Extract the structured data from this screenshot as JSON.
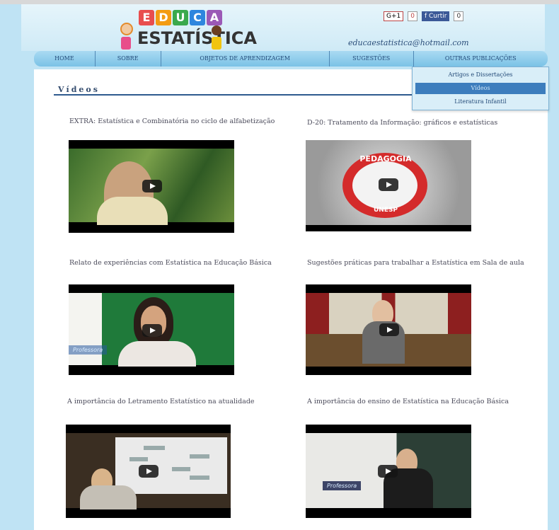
{
  "header": {
    "logo_text_top": "EDUCA",
    "logo_text_bottom": "ESTATÍSTICA",
    "email": "educaestatistica@hotmail.com",
    "social": {
      "gplus": "G+1",
      "gplus_count": "0",
      "like_label": "Curtir",
      "like_count": "0"
    }
  },
  "nav": {
    "items": [
      {
        "label": "HOME"
      },
      {
        "label": "SOBRE"
      },
      {
        "label": "OBJETOS DE APRENDIZAGEM"
      },
      {
        "label": "SUGESTÕES"
      },
      {
        "label": "OUTRAS PUBLICAÇÕES"
      }
    ],
    "dropdown": [
      {
        "label": "Artigos e Dissertações"
      },
      {
        "label": "Vídeos"
      },
      {
        "label": "Literatura Infantil"
      }
    ]
  },
  "page": {
    "title": "Vídeos"
  },
  "videos": [
    {
      "title": "EXTRA: Estatística e Combinatória no ciclo de alfabetização"
    },
    {
      "title": "D-20: Tratamento da Informação: gráficos e estatísticas"
    },
    {
      "title": "Relato de experiências com Estatística na Educação Básica"
    },
    {
      "title": "Sugestões práticas para trabalhar a Estatística em Sala de aula"
    },
    {
      "title": "A importância do Letramento Estatístico na atualidade"
    },
    {
      "title": "A importância do ensino de Estatística na Educação Básica"
    }
  ],
  "video_overlays": {
    "pedagogia_top": "PEDAGOGIA",
    "pedagogia_bottom": "UNESP",
    "banner": "Professora"
  },
  "colors": {
    "background": "#bfe3f4",
    "nav": "#7bc2e6",
    "accent": "#2e5a8e"
  }
}
